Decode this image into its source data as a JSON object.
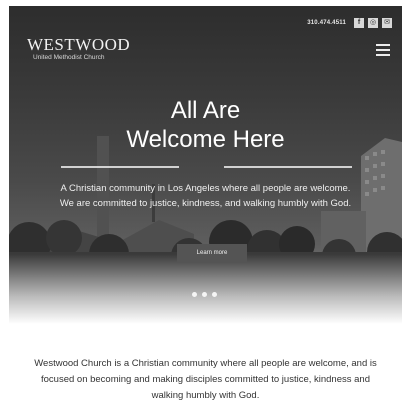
{
  "header": {
    "phone": "310.474.4511",
    "social": [
      {
        "icon": "facebook-icon",
        "glyph": "f"
      },
      {
        "icon": "instagram-icon",
        "glyph": "◎"
      },
      {
        "icon": "email-icon",
        "glyph": "✉"
      }
    ],
    "logo_name": "WESTWOOD",
    "logo_sub": "United Methodist Church"
  },
  "hero": {
    "headline_line1": "All Are",
    "headline_line2": "Welcome Here",
    "tagline": "A Christian community in Los Angeles where all people are welcome. We are committed to justice, kindness, and walking humbly with God.",
    "cta_label": "Learn more",
    "slide_count": 3
  },
  "intro": {
    "text": "Westwood Church is a Christian community where all people are welcome, and is focused on becoming and making disciples committed to justice, kindness and walking humbly with God."
  }
}
